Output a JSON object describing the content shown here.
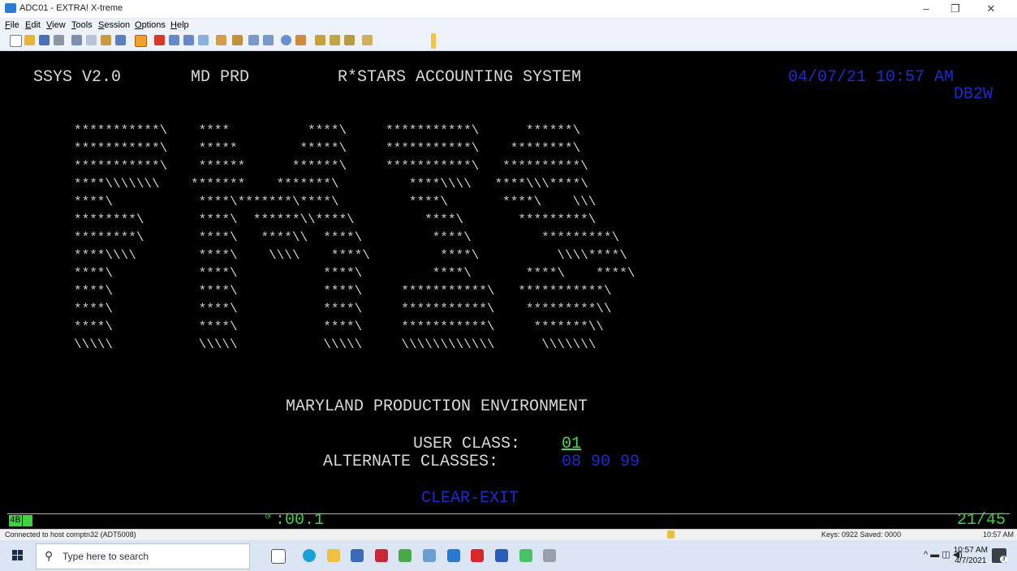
{
  "window": {
    "title": "ADC01 - EXTRA! X-treme",
    "controls": {
      "minimize": "–",
      "restore": "❐",
      "close": "✕"
    }
  },
  "menu": [
    "File",
    "Edit",
    "View",
    "Tools",
    "Session",
    "Options",
    "Help"
  ],
  "toolbar": {
    "icons": [
      "new-session-icon",
      "open-icon",
      "save-icon",
      "print-icon",
      "cut-icon",
      "copy-icon",
      "paste-icon",
      "undo-icon",
      "macro-icon",
      "pen-icon",
      "arrow-left-icon",
      "arrow-right-icon",
      "home-icon",
      "tool-a-icon",
      "tool-b-icon",
      "tool-c-icon",
      "tool-d-icon",
      "tool-e-icon",
      "tool-f-icon",
      "tool-g-icon",
      "tool-h-icon",
      "tool-i-icon",
      "tool-j-icon"
    ]
  },
  "terminal": {
    "system_id": "SSYS V2.0",
    "region": "MD PRD",
    "system_name": "R*STARS ACCOUNTING SYSTEM",
    "datetime": "04/07/21 10:57 AM",
    "db_id": "DB2W",
    "logo_art": [
      "***********\\    ****          ****\\     ***********\\      ******\\",
      "***********\\    *****        *****\\     ***********\\    ********\\",
      "***********\\    ******      ******\\     ***********\\   **********\\",
      "****\\\\\\\\\\\\\\    *******    *******\\         ****\\\\\\\\   ****\\\\\\****\\",
      "****\\           ****\\*******\\****\\         ****\\       ****\\    \\\\\\",
      "********\\       ****\\  ******\\\\****\\         ****\\       *********\\",
      "********\\       ****\\   ****\\\\  ****\\         ****\\         *********\\",
      "****\\\\\\\\        ****\\    \\\\\\\\    ****\\         ****\\          \\\\\\\\****\\",
      "****\\           ****\\           ****\\         ****\\       ****\\    ****\\",
      "****\\           ****\\           ****\\     ***********\\   ***********\\",
      "****\\           ****\\           ****\\     ***********\\    *********\\\\",
      "****\\           ****\\           ****\\     ***********\\     *******\\\\",
      "\\\\\\\\\\           \\\\\\\\\\           \\\\\\\\\\     \\\\\\\\\\\\\\\\\\\\\\\\      \\\\\\\\\\\\\\"
    ],
    "environment": "MARYLAND PRODUCTION ENVIRONMENT",
    "user_class_label": "USER CLASS:",
    "user_class_value": "01",
    "alt_classes_label": "ALTERNATE CLASSES:",
    "alt_classes_value": "08 90 99",
    "clear_exit": "CLEAR-EXIT"
  },
  "term_status": {
    "oia_label": "4B",
    "elapsed": ":00.1",
    "cursor_pos": "21/45"
  },
  "statusbar": {
    "connection": "Connected to host comptn32 (ADT5008)",
    "keys": "Keys: 0922 Saved: 0000",
    "time": "10:57 AM"
  },
  "taskbar": {
    "search_placeholder": "Type here to search",
    "clock_time": "10:57 AM",
    "clock_date": "4/7/2021",
    "notification_count": "3"
  }
}
